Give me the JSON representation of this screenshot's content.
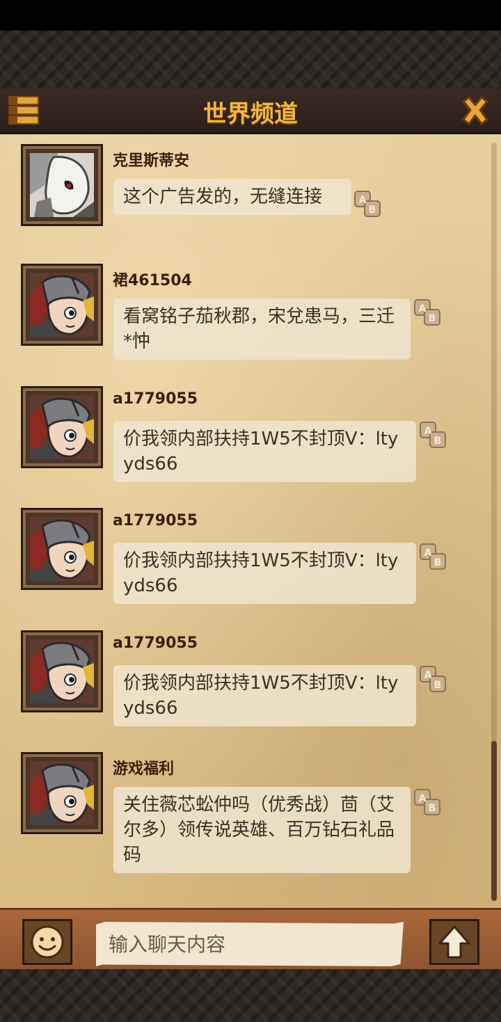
{
  "header": {
    "title": "世界频道",
    "menu_icon": "menu-list-icon",
    "close_icon": "close-x-icon"
  },
  "messages": [
    {
      "username": "克里斯蒂安",
      "text": "这个广告发的，无缝连接",
      "avatar": "masked-knight-avatar"
    },
    {
      "username": "裙461504",
      "text": "看窝铭子茄秋郡，宋兌患马，三迁*忡",
      "avatar": "helmet-warrior-avatar"
    },
    {
      "username": "a1779055",
      "text": "价我领内部扶持1W5不封顶V：ltyyds66",
      "avatar": "helmet-warrior-avatar"
    },
    {
      "username": "a1779055",
      "text": "价我领内部扶持1W5不封顶V：ltyyds66",
      "avatar": "helmet-warrior-avatar"
    },
    {
      "username": "a1779055",
      "text": "价我领内部扶持1W5不封顶V：ltyyds66",
      "avatar": "helmet-warrior-avatar"
    },
    {
      "username": "游戏福利",
      "text": "关住薇芯蚣仲吗（优秀战）茴（艾尔多）领传说英雄、百万钻石礼品码",
      "avatar": "helmet-warrior-avatar"
    }
  ],
  "translate_icon": "translate-ab-icon",
  "input": {
    "placeholder": "输入聊天内容",
    "value": ""
  },
  "colors": {
    "title": "#f0b640",
    "parchment": "#e7cf9e",
    "bubble": "#eee4cd",
    "bottom_bar": "#a9683a"
  }
}
